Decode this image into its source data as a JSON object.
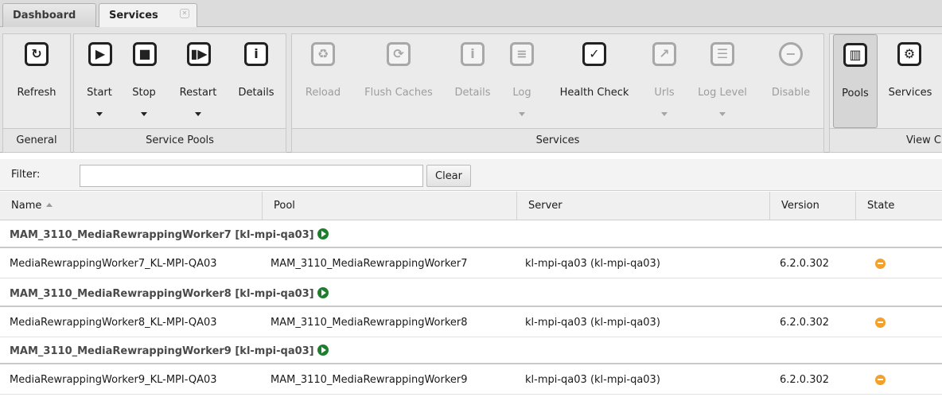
{
  "tabs": [
    {
      "label": "Dashboard",
      "active": false
    },
    {
      "label": "Services",
      "active": true,
      "closable": true
    }
  ],
  "ribbon": {
    "groups": [
      {
        "title": "General",
        "buttons": [
          {
            "label": "Refresh",
            "icon": "refresh-icon"
          }
        ]
      },
      {
        "title": "Service Pools",
        "buttons": [
          {
            "label": "Start",
            "icon": "play-icon",
            "dropdown": true
          },
          {
            "label": "Stop",
            "icon": "stop-icon",
            "dropdown": true
          },
          {
            "label": "Restart",
            "icon": "restart-icon",
            "dropdown": true
          },
          {
            "label": "Details",
            "icon": "info-icon"
          }
        ]
      },
      {
        "title": "Services",
        "buttons": [
          {
            "label": "Reload",
            "icon": "recycle-icon",
            "disabled": true
          },
          {
            "label": "Flush Caches",
            "icon": "flush-icon",
            "disabled": true
          },
          {
            "label": "Details",
            "icon": "info-icon",
            "disabled": true
          },
          {
            "label": "Log",
            "icon": "log-icon",
            "disabled": true,
            "dropdown": true
          },
          {
            "label": "Health Check",
            "icon": "health-check-icon"
          },
          {
            "label": "Urls",
            "icon": "external-link-icon",
            "disabled": true,
            "dropdown": true
          },
          {
            "label": "Log Level",
            "icon": "log-level-icon",
            "disabled": true,
            "dropdown": true
          },
          {
            "label": "Disable",
            "icon": "disable-icon",
            "disabled": true
          }
        ]
      },
      {
        "title": "View C",
        "buttons": [
          {
            "label": "Pools",
            "icon": "pools-icon",
            "pressed": true
          },
          {
            "label": "Services",
            "icon": "gears-icon"
          }
        ]
      }
    ]
  },
  "filter": {
    "label": "Filter:",
    "value": "",
    "clear_label": "Clear"
  },
  "grid": {
    "columns": [
      "Name",
      "Pool",
      "Server",
      "Version",
      "State"
    ],
    "sorted_column": "Name",
    "groups": [
      {
        "title": "MAM_3110_MediaRewrappingWorker7  [kl-mpi-qa03]",
        "row": {
          "name": "MediaRewrappingWorker7_KL-MPI-QA03",
          "pool": "MAM_3110_MediaRewrappingWorker7",
          "server": "kl-mpi-qa03 (kl-mpi-qa03)",
          "version": "6.2.0.302",
          "state": "stopped"
        }
      },
      {
        "title": "MAM_3110_MediaRewrappingWorker8  [kl-mpi-qa03]",
        "row": {
          "name": "MediaRewrappingWorker8_KL-MPI-QA03",
          "pool": "MAM_3110_MediaRewrappingWorker8",
          "server": "kl-mpi-qa03 (kl-mpi-qa03)",
          "version": "6.2.0.302",
          "state": "stopped"
        }
      },
      {
        "title": "MAM_3110_MediaRewrappingWorker9  [kl-mpi-qa03]",
        "row": {
          "name": "MediaRewrappingWorker9_KL-MPI-QA03",
          "pool": "MAM_3110_MediaRewrappingWorker9",
          "server": "kl-mpi-qa03 (kl-mpi-qa03)",
          "version": "6.2.0.302",
          "state": "stopped"
        }
      }
    ]
  },
  "colors": {
    "state_stopped": "#f3a12a",
    "pool_running": "#1e7e2e"
  }
}
